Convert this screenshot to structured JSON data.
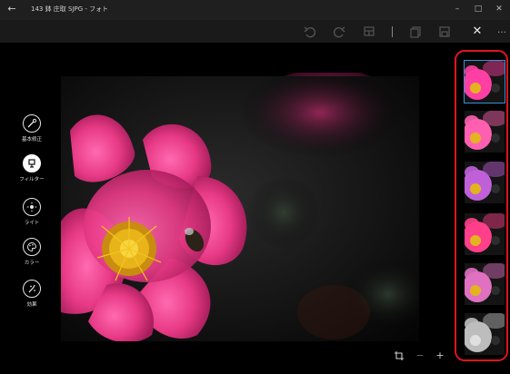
{
  "window": {
    "title": "143 鉢 庄取 SJPG - フォト",
    "back_icon": "back-arrow-icon",
    "minimize_label": "–",
    "maximize_label": "□",
    "close_label": "✕"
  },
  "toolbar": {
    "undo_icon": "undo-icon",
    "redo_icon": "redo-icon",
    "compare_icon": "compare-icon",
    "copy_icon": "save-copy-icon",
    "save_icon": "save-icon",
    "close_label": "✕",
    "more_label": "…"
  },
  "tools": [
    {
      "label": "基本修正",
      "icon": "wand-icon"
    },
    {
      "label": "フィルター",
      "icon": "filter-icon"
    },
    {
      "label": "ライト",
      "icon": "light-icon"
    },
    {
      "label": "カラー",
      "icon": "color-palette-icon"
    },
    {
      "label": "効果",
      "icon": "effects-icon"
    }
  ],
  "active_tool": "フィルター",
  "filters": [
    {
      "name": "original",
      "tint": "#ff3fa3",
      "selected": true
    },
    {
      "name": "filter-2",
      "tint": "#ff5fb0",
      "selected": false
    },
    {
      "name": "filter-3",
      "tint": "#c060d8",
      "selected": false
    },
    {
      "name": "filter-4",
      "tint": "#ff3f8a",
      "selected": false
    },
    {
      "name": "filter-5",
      "tint": "#e070c0",
      "selected": false
    },
    {
      "name": "mono",
      "tint": "#bdbdbd",
      "selected": false
    }
  ],
  "bottom_bar": {
    "crop_icon": "crop-icon",
    "zoom_out_label": "−",
    "zoom_in_label": "+"
  },
  "colors": {
    "accent": "#3c8fd8",
    "annotation": "#e0141c",
    "flower": "#ec3f8a"
  }
}
